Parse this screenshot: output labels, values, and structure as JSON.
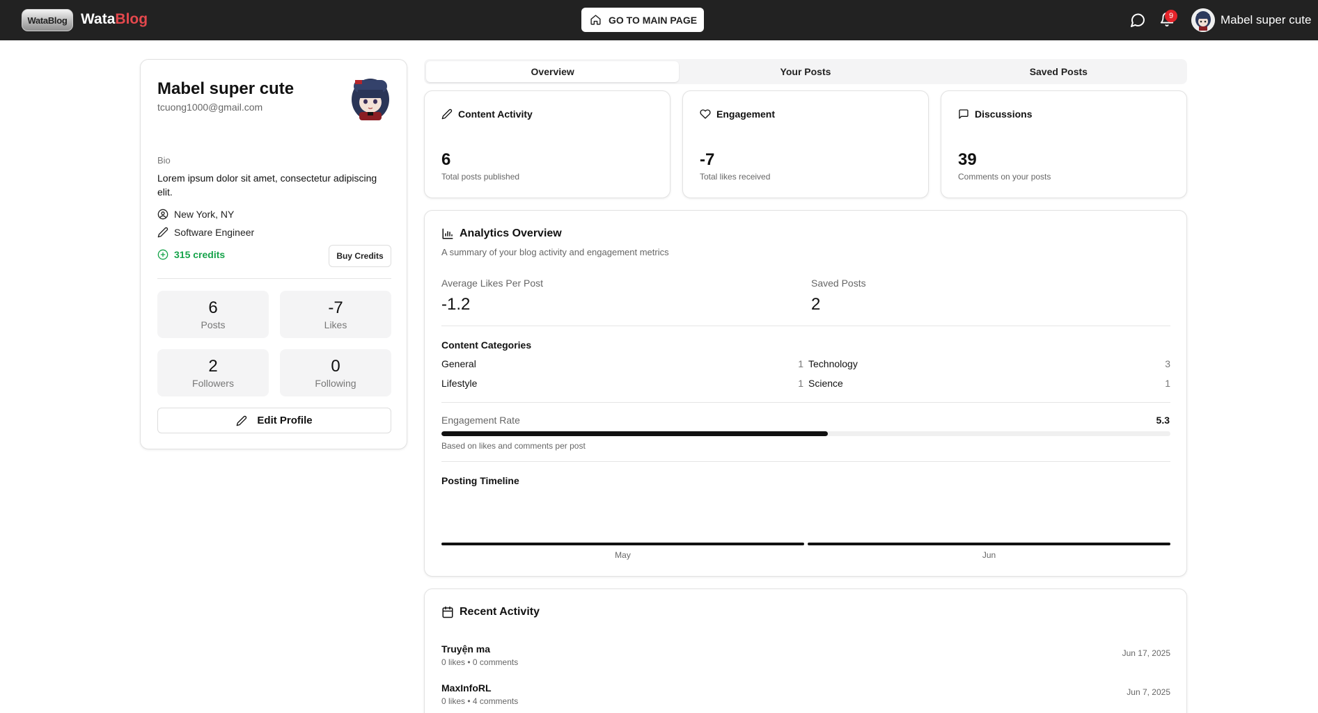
{
  "header": {
    "logo_text": "WataBlog",
    "brand_first": "Wata",
    "brand_second": "Blog",
    "main_page_label": "GO TO MAIN PAGE",
    "notification_count": "9",
    "user_name": "Mabel super cute"
  },
  "profile": {
    "name": "Mabel super cute",
    "email": "tcuong1000@gmail.com",
    "bio_label": "Bio",
    "bio": "Lorem ipsum dolor sit amet, consectetur adipiscing elit.",
    "location": "New York, NY",
    "occupation": "Software Engineer",
    "credits": "315 credits",
    "buy_credits_label": "Buy Credits",
    "stats": [
      {
        "value": "6",
        "label": "Posts"
      },
      {
        "value": "-7",
        "label": "Likes"
      },
      {
        "value": "2",
        "label": "Followers"
      },
      {
        "value": "0",
        "label": "Following"
      }
    ],
    "edit_label": "Edit Profile"
  },
  "tabs": [
    {
      "label": "Overview",
      "active": true
    },
    {
      "label": "Your Posts",
      "active": false
    },
    {
      "label": "Saved Posts",
      "active": false
    }
  ],
  "stat_cards": [
    {
      "title": "Content Activity",
      "value": "6",
      "subtitle": "Total posts published",
      "icon": "pencil-icon"
    },
    {
      "title": "Engagement",
      "value": "-7",
      "subtitle": "Total likes received",
      "icon": "heart-icon"
    },
    {
      "title": "Discussions",
      "value": "39",
      "subtitle": "Comments on your posts",
      "icon": "message-square-icon"
    }
  ],
  "analytics": {
    "title": "Analytics Overview",
    "description": "A summary of your blog activity and engagement metrics",
    "avg_likes_label": "Average Likes Per Post",
    "avg_likes_value": "-1.2",
    "saved_posts_label": "Saved Posts",
    "saved_posts_value": "2",
    "categories_title": "Content Categories",
    "categories": [
      {
        "name": "General",
        "count": "1"
      },
      {
        "name": "Technology",
        "count": "3"
      },
      {
        "name": "Lifestyle",
        "count": "1"
      },
      {
        "name": "Science",
        "count": "1"
      }
    ],
    "engagement_label": "Engagement Rate",
    "engagement_value": "5.3",
    "engagement_fraction": 0.53,
    "engagement_note": "Based on likes and comments per post",
    "timeline_title": "Posting Timeline",
    "timeline": [
      {
        "month": "May"
      },
      {
        "month": "Jun"
      }
    ]
  },
  "recent": {
    "title": "Recent Activity",
    "items": [
      {
        "title": "Truyện ma",
        "meta": "0 likes • 0 comments",
        "date": "Jun 17, 2025"
      },
      {
        "title": "MaxInfoRL",
        "meta": "0 likes • 4 comments",
        "date": "Jun 7, 2025"
      }
    ]
  },
  "colors": {
    "header_bg": "#222222",
    "brand_accent": "#e5484d",
    "credits_green": "#16a34a",
    "badge_red": "#e5242b"
  }
}
